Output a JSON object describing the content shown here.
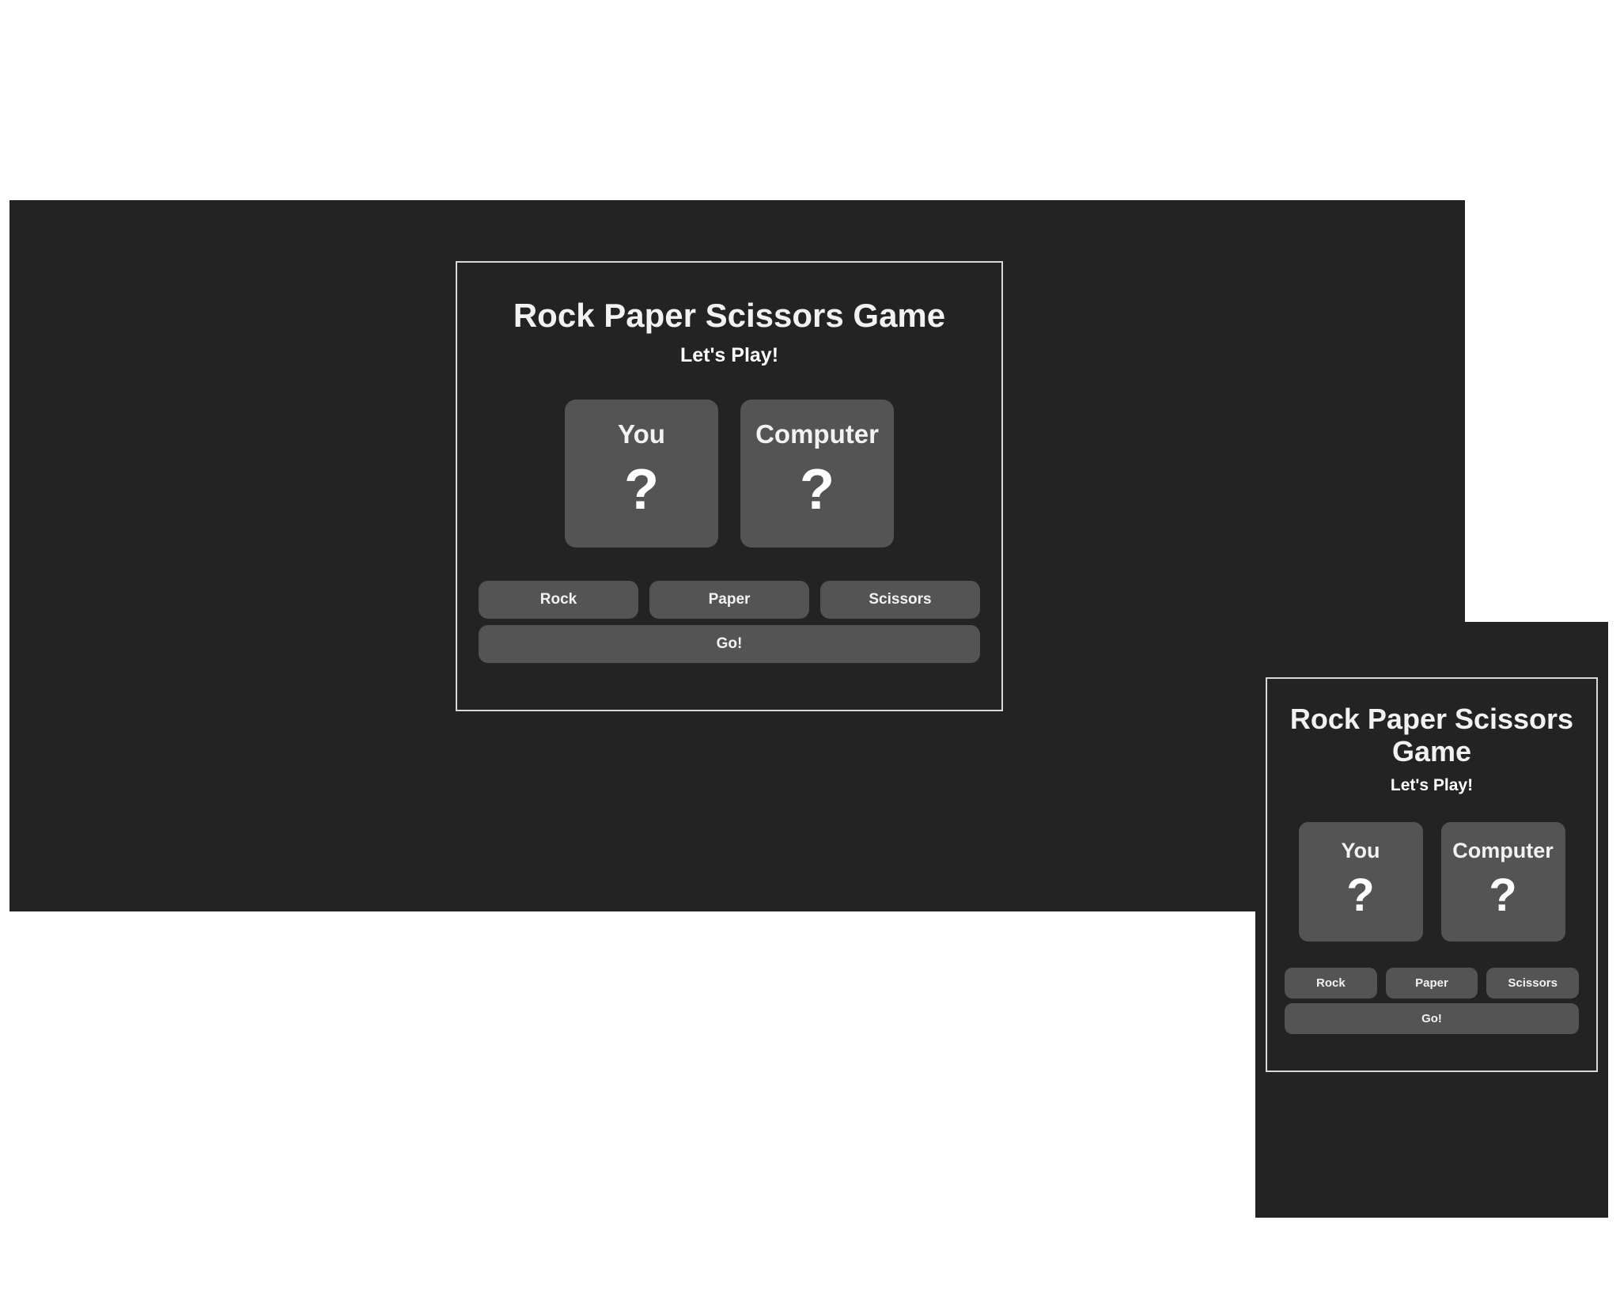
{
  "game": {
    "title": "Rock Paper Scissors Game",
    "subtitle": "Let's Play!",
    "player_label": "You",
    "computer_label": "Computer",
    "unknown_icon": "?",
    "buttons": {
      "rock": "Rock",
      "paper": "Paper",
      "scissors": "Scissors",
      "go": "Go!"
    }
  },
  "colors": {
    "panel_background": "#232323",
    "card_background": "#545454",
    "frame_border": "#d9d9d9",
    "text": "#f2f2f2"
  }
}
